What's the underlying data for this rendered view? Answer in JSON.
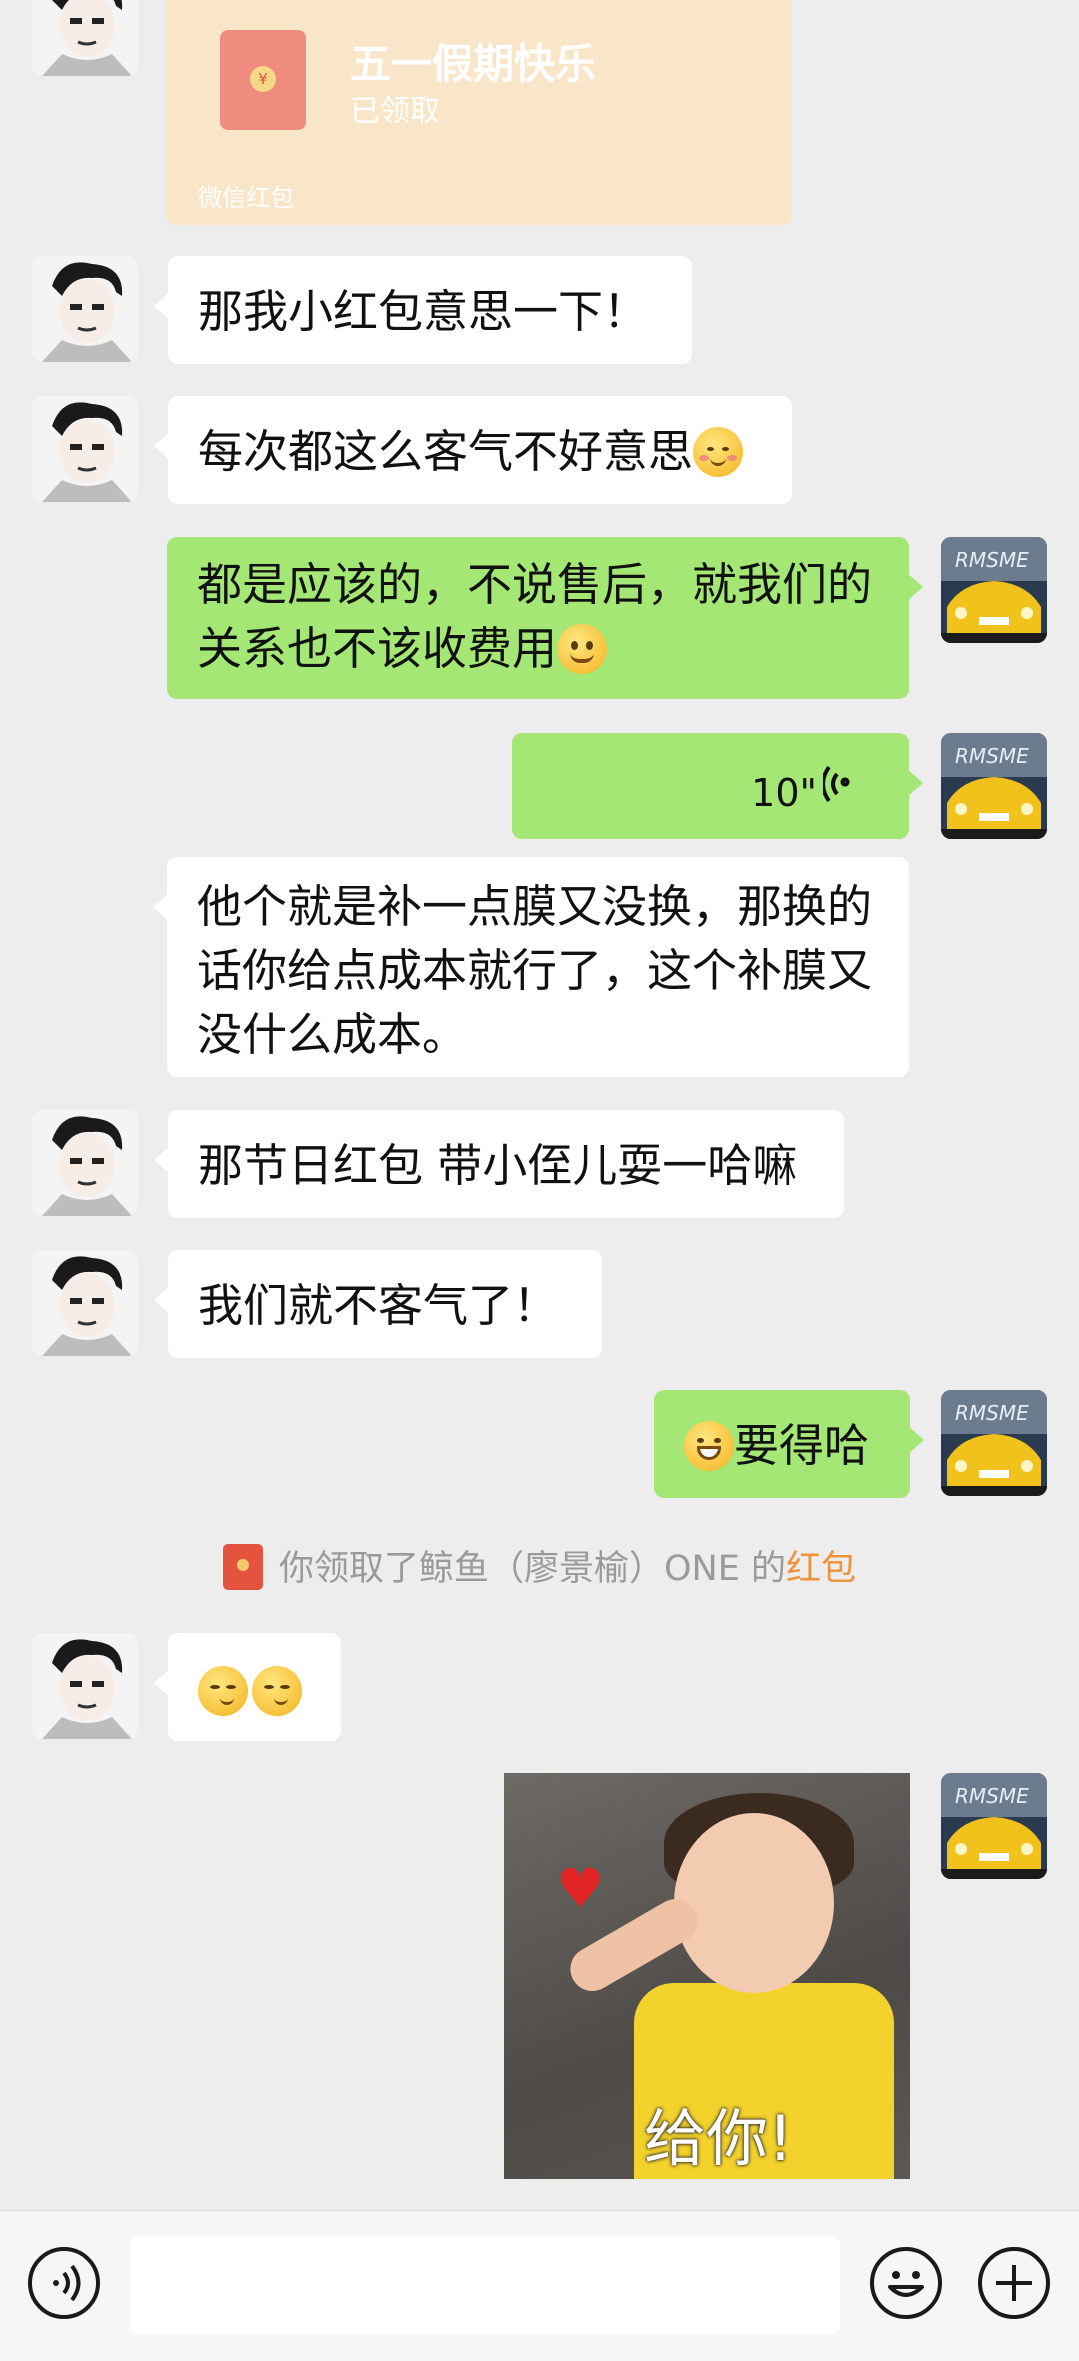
{
  "red_packet": {
    "title": "五一假期快乐",
    "status": "已领取",
    "footer": "微信红包",
    "seal": "¥"
  },
  "messages": [
    {
      "side": "in",
      "text": "那我小红包意思一下！"
    },
    {
      "side": "in",
      "text": "每次都这么客气不好意思",
      "emoji": "blush-emoji"
    },
    {
      "side": "out",
      "line1": "都是应该的，不说售后，就我们的",
      "line2": "关系也不该收费用",
      "emoji": "smile-emoji"
    },
    {
      "side": "out",
      "type": "voice",
      "duration": "10\""
    },
    {
      "side": "in",
      "line1": "他个就是补一点膜又没换，那换的",
      "line2": "话你给点成本就行了，这个补膜又",
      "line3": "没什么成本。"
    },
    {
      "side": "in",
      "text": "那节日红包 带小侄儿耍一哈嘛"
    },
    {
      "side": "in",
      "text": "我们就不客气了！"
    },
    {
      "side": "out",
      "text": "要得哈",
      "emoji": "grin-emoji"
    },
    {
      "side": "in",
      "type": "emoji-only",
      "emoji": "smirk-emoji"
    }
  ],
  "system_note": {
    "prefix": "你领取了鲸鱼（廖景榆）ONE 的",
    "link": "红包"
  },
  "sticker": {
    "caption": "给你!",
    "heart": "♥"
  },
  "input_bar": {
    "placeholder": ""
  }
}
